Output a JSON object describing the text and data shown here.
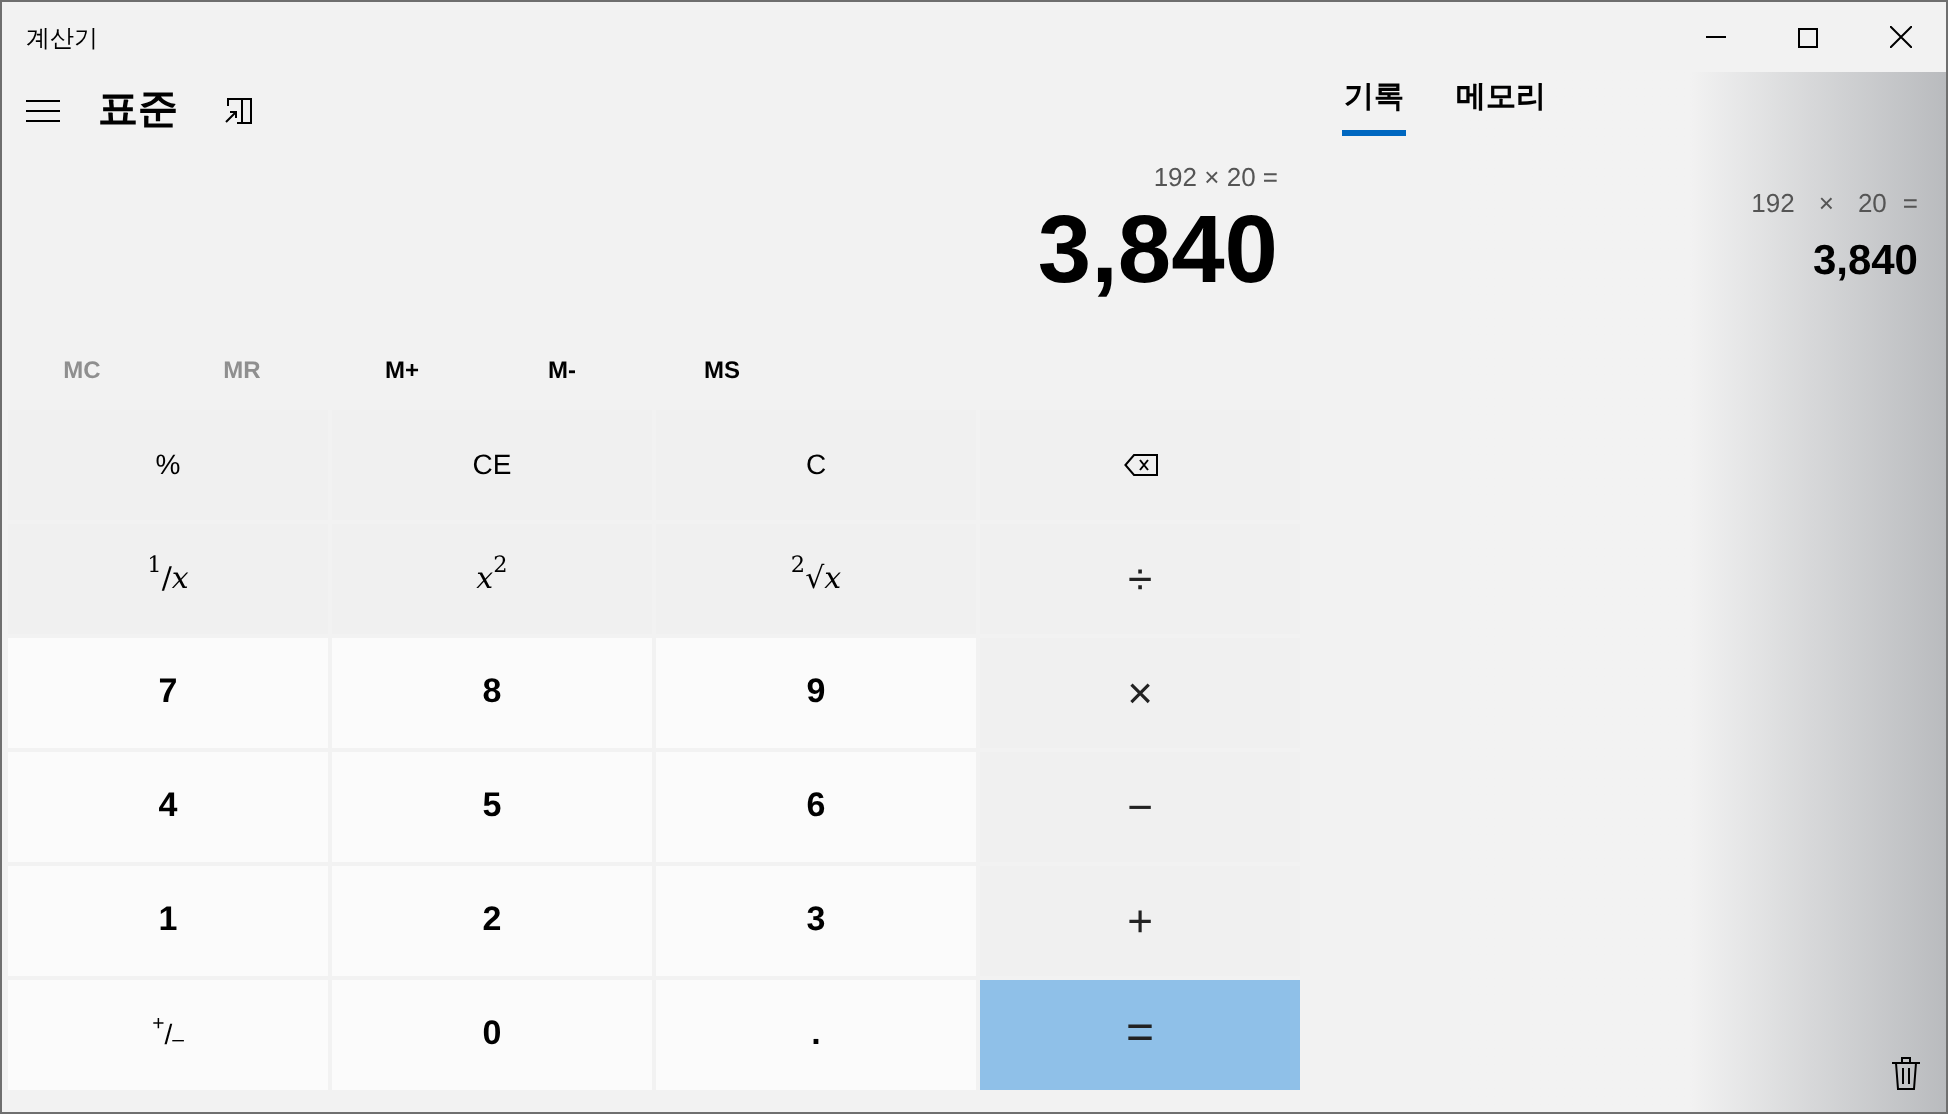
{
  "window": {
    "title": "계산기"
  },
  "mode": {
    "title": "표준"
  },
  "display": {
    "expression": "192 × 20 =",
    "result": "3,840"
  },
  "memory_buttons": [
    {
      "label": "MC",
      "disabled": true
    },
    {
      "label": "MR",
      "disabled": true
    },
    {
      "label": "M+",
      "disabled": false
    },
    {
      "label": "M-",
      "disabled": false
    },
    {
      "label": "MS",
      "disabled": false
    }
  ],
  "keys": [
    {
      "kind": "func",
      "label": "%"
    },
    {
      "kind": "func",
      "label": "CE"
    },
    {
      "kind": "func",
      "label": "C"
    },
    {
      "kind": "backspace"
    },
    {
      "kind": "math",
      "label": "$^{1}$/*x*"
    },
    {
      "kind": "math",
      "label": "*x*$^{2}$"
    },
    {
      "kind": "math",
      "label": "$^{2}$√*x*"
    },
    {
      "kind": "op",
      "label": "÷"
    },
    {
      "kind": "digit",
      "label": "7"
    },
    {
      "kind": "digit",
      "label": "8"
    },
    {
      "kind": "digit",
      "label": "9"
    },
    {
      "kind": "op",
      "label": "×"
    },
    {
      "kind": "digit",
      "label": "4"
    },
    {
      "kind": "digit",
      "label": "5"
    },
    {
      "kind": "digit",
      "label": "6"
    },
    {
      "kind": "op",
      "label": "−"
    },
    {
      "kind": "digit",
      "label": "1"
    },
    {
      "kind": "digit",
      "label": "2"
    },
    {
      "kind": "digit",
      "label": "3"
    },
    {
      "kind": "op",
      "label": "+"
    },
    {
      "kind": "sign",
      "label": "$^{+}$/$_{–}$"
    },
    {
      "kind": "digit",
      "label": "0"
    },
    {
      "kind": "digit",
      "label": "."
    },
    {
      "kind": "equals",
      "label": "="
    }
  ],
  "tabs": [
    {
      "label": "기록",
      "selected": true
    },
    {
      "label": "메모리",
      "selected": false
    }
  ],
  "history": [
    {
      "operand_1": "192",
      "operator": "×",
      "operand_2": "20",
      "equals": "=",
      "result": "3,840"
    }
  ]
}
